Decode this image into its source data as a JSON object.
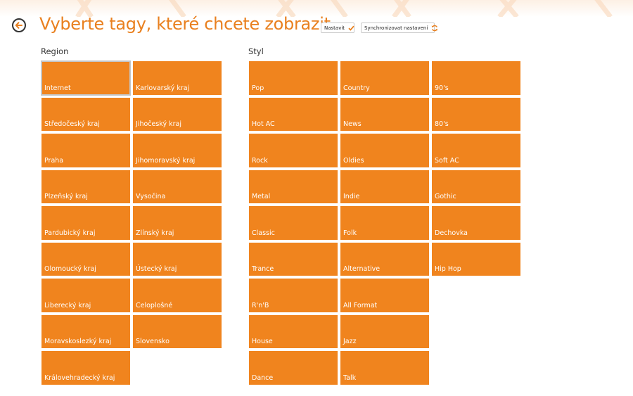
{
  "header": {
    "title": "Vyberte tagy, které chcete zobrazit",
    "back_icon": "back-arrow-icon",
    "accent_color": "#f0841e"
  },
  "toolbar": {
    "set_label": "Nastavit",
    "set_icon": "checkmark-icon",
    "sync_label": "Synchronizovat nastavení",
    "sync_icon": "sync-icon"
  },
  "region": {
    "title": "Region",
    "tiles": [
      {
        "label": "Internet",
        "selected": true
      },
      {
        "label": "Karlovarský kraj"
      },
      {
        "label": "Středočeský kraj"
      },
      {
        "label": "Jihočeský kraj"
      },
      {
        "label": "Praha"
      },
      {
        "label": "Jihomoravský kraj"
      },
      {
        "label": "Plzeňský kraj"
      },
      {
        "label": "Vysočina"
      },
      {
        "label": "Pardubický kraj"
      },
      {
        "label": "Zlínský kraj"
      },
      {
        "label": "Olomoucký kraj"
      },
      {
        "label": "Ústecký kraj"
      },
      {
        "label": "Liberecký kraj"
      },
      {
        "label": "Celoplošné"
      },
      {
        "label": "Moravskoslezký kraj"
      },
      {
        "label": "Slovensko"
      },
      {
        "label": "Královehradecký kraj"
      }
    ]
  },
  "styl": {
    "title": "Styl",
    "tiles": [
      {
        "label": "Pop"
      },
      {
        "label": "Country"
      },
      {
        "label": "90's"
      },
      {
        "label": "Hot AC"
      },
      {
        "label": "News"
      },
      {
        "label": "80's"
      },
      {
        "label": "Rock"
      },
      {
        "label": "Oldies"
      },
      {
        "label": "Soft AC"
      },
      {
        "label": "Metal"
      },
      {
        "label": "Indie"
      },
      {
        "label": "Gothic"
      },
      {
        "label": "Classic"
      },
      {
        "label": "Folk"
      },
      {
        "label": "Dechovka"
      },
      {
        "label": "Trance"
      },
      {
        "label": "Alternative"
      },
      {
        "label": "Hip Hop"
      },
      {
        "label": "R'n'B"
      },
      {
        "label": "All Format"
      },
      {
        "label": "",
        "empty": true
      },
      {
        "label": "House"
      },
      {
        "label": "Jazz"
      },
      {
        "label": "",
        "empty": true
      },
      {
        "label": "Dance"
      },
      {
        "label": "Talk"
      }
    ]
  }
}
